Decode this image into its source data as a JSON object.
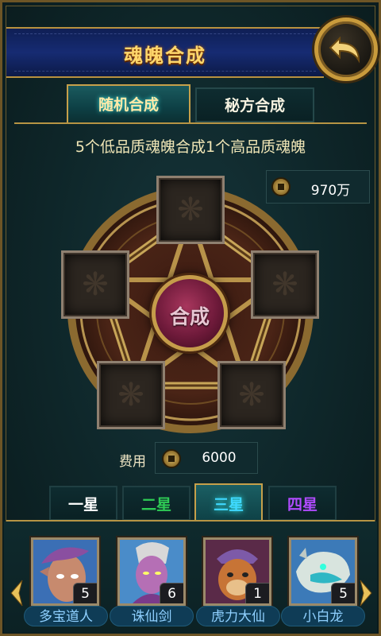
{
  "header": {
    "title": "魂魄合成"
  },
  "tabs": [
    {
      "label": "随机合成",
      "active": true
    },
    {
      "label": "秘方合成",
      "active": false
    }
  ],
  "description": "5个低品质魂魄合成1个高品质魂魄",
  "money": {
    "icon": "coin-icon",
    "value": "970万"
  },
  "synthesis": {
    "center_label": "合成",
    "slots": 5
  },
  "cost": {
    "label": "费用",
    "icon": "coin-icon",
    "value": "6000"
  },
  "star_tabs": [
    {
      "label": "一星",
      "color": "#ffffff",
      "active": false
    },
    {
      "label": "二星",
      "color": "#2ecc55",
      "active": false
    },
    {
      "label": "三星",
      "color": "#3fd8ff",
      "active": true
    },
    {
      "label": "四星",
      "color": "#b04bff",
      "active": false
    }
  ],
  "heroes": [
    {
      "name": "多宝道人",
      "count": "5"
    },
    {
      "name": "诛仙剑",
      "count": "6"
    },
    {
      "name": "虎力大仙",
      "count": "1"
    },
    {
      "name": "小白龙",
      "count": "5"
    }
  ]
}
